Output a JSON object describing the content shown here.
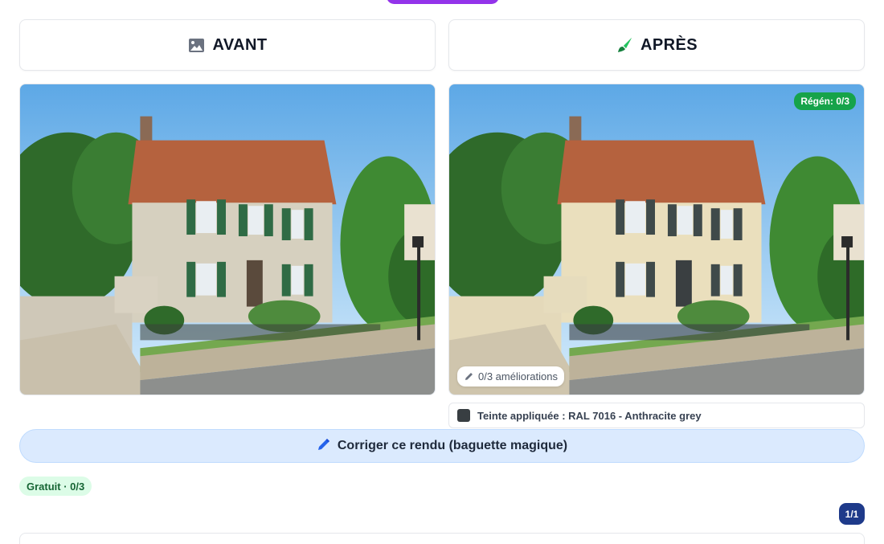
{
  "header": {
    "before_label": "AVANT",
    "before_icon": "image-icon",
    "after_label": "APRÈS",
    "after_icon": "brush-icon"
  },
  "after_panel": {
    "regen_badge": "Régén: 0/3",
    "improvements_chip": "0/3 améliorations"
  },
  "tint": {
    "label": "Teinte appliquée : RAL 7016 - Anthracite grey",
    "swatch_color": "#383e42"
  },
  "actions": {
    "fix_button_label": "Corriger ce rendu (baguette magique)"
  },
  "quota": {
    "label": "Gratuit · 0/3"
  },
  "pagination": {
    "label": "1/1"
  },
  "colors": {
    "accent_purple": "#9333ea",
    "success_green": "#16a34a",
    "button_blue_bg": "#dbeafe",
    "counter_navy": "#1e3a8a"
  }
}
